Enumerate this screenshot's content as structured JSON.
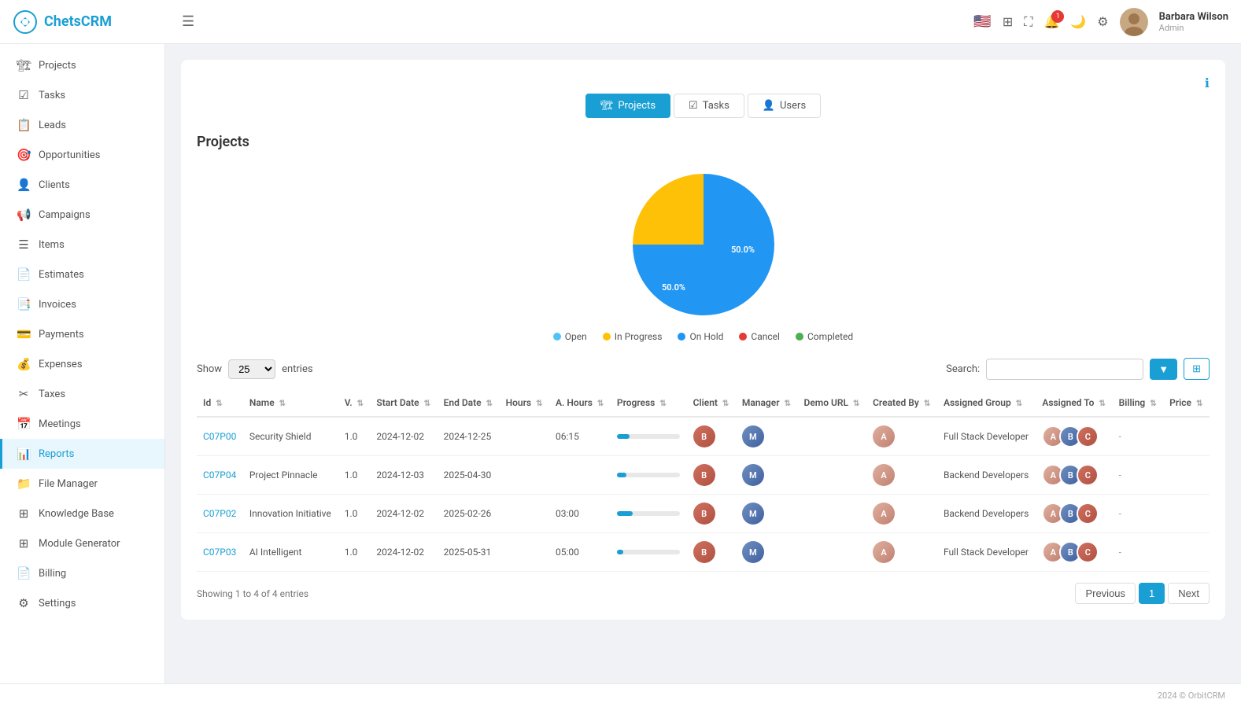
{
  "header": {
    "logo_text": "ChetsCRM",
    "hamburger_label": "☰",
    "user": {
      "name": "Barbara Wilson",
      "role": "Admin"
    },
    "notification_count": "1"
  },
  "sidebar": {
    "items": [
      {
        "id": "projects",
        "label": "Projects",
        "icon": "🏗",
        "active": false
      },
      {
        "id": "tasks",
        "label": "Tasks",
        "icon": "☑",
        "active": false
      },
      {
        "id": "leads",
        "label": "Leads",
        "icon": "📋",
        "active": false
      },
      {
        "id": "opportunities",
        "label": "Opportunities",
        "icon": "🎯",
        "active": false
      },
      {
        "id": "clients",
        "label": "Clients",
        "icon": "👤",
        "active": false
      },
      {
        "id": "campaigns",
        "label": "Campaigns",
        "icon": "📢",
        "active": false
      },
      {
        "id": "items",
        "label": "Items",
        "icon": "☰",
        "active": false
      },
      {
        "id": "estimates",
        "label": "Estimates",
        "icon": "📄",
        "active": false
      },
      {
        "id": "invoices",
        "label": "Invoices",
        "icon": "📑",
        "active": false
      },
      {
        "id": "payments",
        "label": "Payments",
        "icon": "💳",
        "active": false
      },
      {
        "id": "expenses",
        "label": "Expenses",
        "icon": "💰",
        "active": false
      },
      {
        "id": "taxes",
        "label": "Taxes",
        "icon": "✂",
        "active": false
      },
      {
        "id": "meetings",
        "label": "Meetings",
        "icon": "📅",
        "active": false
      },
      {
        "id": "reports",
        "label": "Reports",
        "icon": "📊",
        "active": true
      },
      {
        "id": "file-manager",
        "label": "File Manager",
        "icon": "📁",
        "active": false
      },
      {
        "id": "knowledge-base",
        "label": "Knowledge Base",
        "icon": "⊞",
        "active": false
      },
      {
        "id": "module-generator",
        "label": "Module Generator",
        "icon": "⊞",
        "active": false
      },
      {
        "id": "billing",
        "label": "Billing",
        "icon": "📄",
        "active": false
      },
      {
        "id": "settings",
        "label": "Settings",
        "icon": "⚙",
        "active": false
      }
    ]
  },
  "tabs": [
    {
      "id": "projects",
      "label": "Projects",
      "icon": "🏗",
      "active": true
    },
    {
      "id": "tasks",
      "label": "Tasks",
      "icon": "☑",
      "active": false
    },
    {
      "id": "users",
      "label": "Users",
      "icon": "👤",
      "active": false
    }
  ],
  "page_title": "Projects",
  "chart": {
    "segments": [
      {
        "label": "Open",
        "value": 0,
        "color": "#4fc3f7",
        "pct": 0
      },
      {
        "label": "In Progress",
        "value": 50,
        "color": "#ffc107",
        "pct": 50,
        "display": "50.0%"
      },
      {
        "label": "On Hold",
        "value": 50,
        "color": "#2196f3",
        "pct": 50,
        "display": "50.0%"
      },
      {
        "label": "Cancel",
        "value": 0,
        "color": "#e53935",
        "pct": 0
      },
      {
        "label": "Completed",
        "value": 0,
        "color": "#4caf50",
        "pct": 0
      }
    ]
  },
  "table": {
    "show_entries_label": "Show",
    "show_entries_value": "25",
    "entries_label": "entries",
    "search_label": "Search:",
    "columns": [
      "Id",
      "Name",
      "V.",
      "Start Date",
      "End Date",
      "Hours",
      "A. Hours",
      "Progress",
      "Client",
      "Manager",
      "Demo URL",
      "Created By",
      "Assigned Group",
      "Assigned To",
      "Billing",
      "Price"
    ],
    "rows": [
      {
        "id": "C07P00",
        "name": "Security Shield",
        "version": "1.0",
        "start_date": "2024-12-02",
        "end_date": "2024-12-25",
        "hours": "",
        "a_hours": "06:15",
        "progress": 20,
        "assigned_group": "Full Stack Developer",
        "billing": "-",
        "price": ""
      },
      {
        "id": "C07P04",
        "name": "Project Pinnacle",
        "version": "1.0",
        "start_date": "2024-12-03",
        "end_date": "2025-04-30",
        "hours": "",
        "a_hours": "",
        "progress": 15,
        "assigned_group": "Backend Developers",
        "billing": "-",
        "price": ""
      },
      {
        "id": "C07P02",
        "name": "Innovation Initiative",
        "version": "1.0",
        "start_date": "2024-12-02",
        "end_date": "2025-02-26",
        "hours": "",
        "a_hours": "03:00",
        "progress": 25,
        "assigned_group": "Backend Developers",
        "billing": "-",
        "price": ""
      },
      {
        "id": "C07P03",
        "name": "AI Intelligent",
        "version": "1.0",
        "start_date": "2024-12-02",
        "end_date": "2025-05-31",
        "hours": "",
        "a_hours": "05:00",
        "progress": 10,
        "assigned_group": "Full Stack Developer",
        "billing": "-",
        "price": ""
      }
    ]
  },
  "pagination": {
    "info": "Showing 1 to 4 of 4 entries",
    "previous_label": "Previous",
    "next_label": "Next",
    "current_page": "1"
  },
  "footer": {
    "text": "2024 © OrbitCRM"
  }
}
